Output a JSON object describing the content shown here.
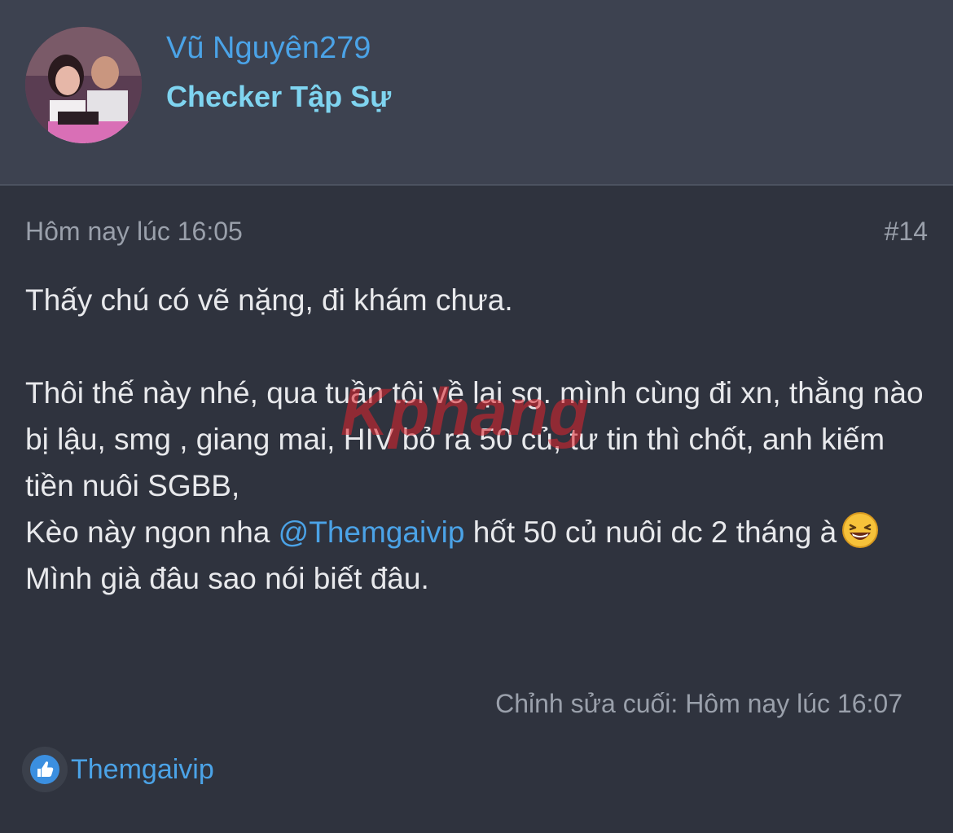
{
  "author": {
    "username": "Vũ Nguyên279",
    "title": "Checker Tập Sự"
  },
  "post": {
    "time": "Hôm nay lúc 16:05",
    "number": "#14",
    "paragraph1": "Thấy chú có vẽ nặng, đi khám chưa.",
    "line1": "Thôi thế này nhé, qua tuần tôi về lại sg. mình cùng đi xn, thằng nào bị lậu, smg , giang mai, HIV bỏ ra 50 củ, tư tin thì chốt, anh kiếm tiền nuôi SGBB,",
    "line2_before": "Kèo này ngon nha ",
    "line2_mention": "@Themgaivip",
    "line2_after": " hốt 50 củ nuôi dc 2 tháng à",
    "line3": "Mình già đâu sao nói biết đâu.",
    "emoji": "laughing-emoji",
    "edited": "Chỉnh sửa cuối: Hôm nay lúc 16:07"
  },
  "reactions": {
    "icon": "thumbs-up-icon",
    "user": "Themgaivip"
  },
  "watermark": {
    "text": "Kphang"
  },
  "colors": {
    "link": "#4ba3e7",
    "title": "#7fd4f0",
    "text": "#e8e9ec",
    "muted": "#9aa0ab",
    "background": "#2f333e",
    "header": "#3d4250"
  }
}
